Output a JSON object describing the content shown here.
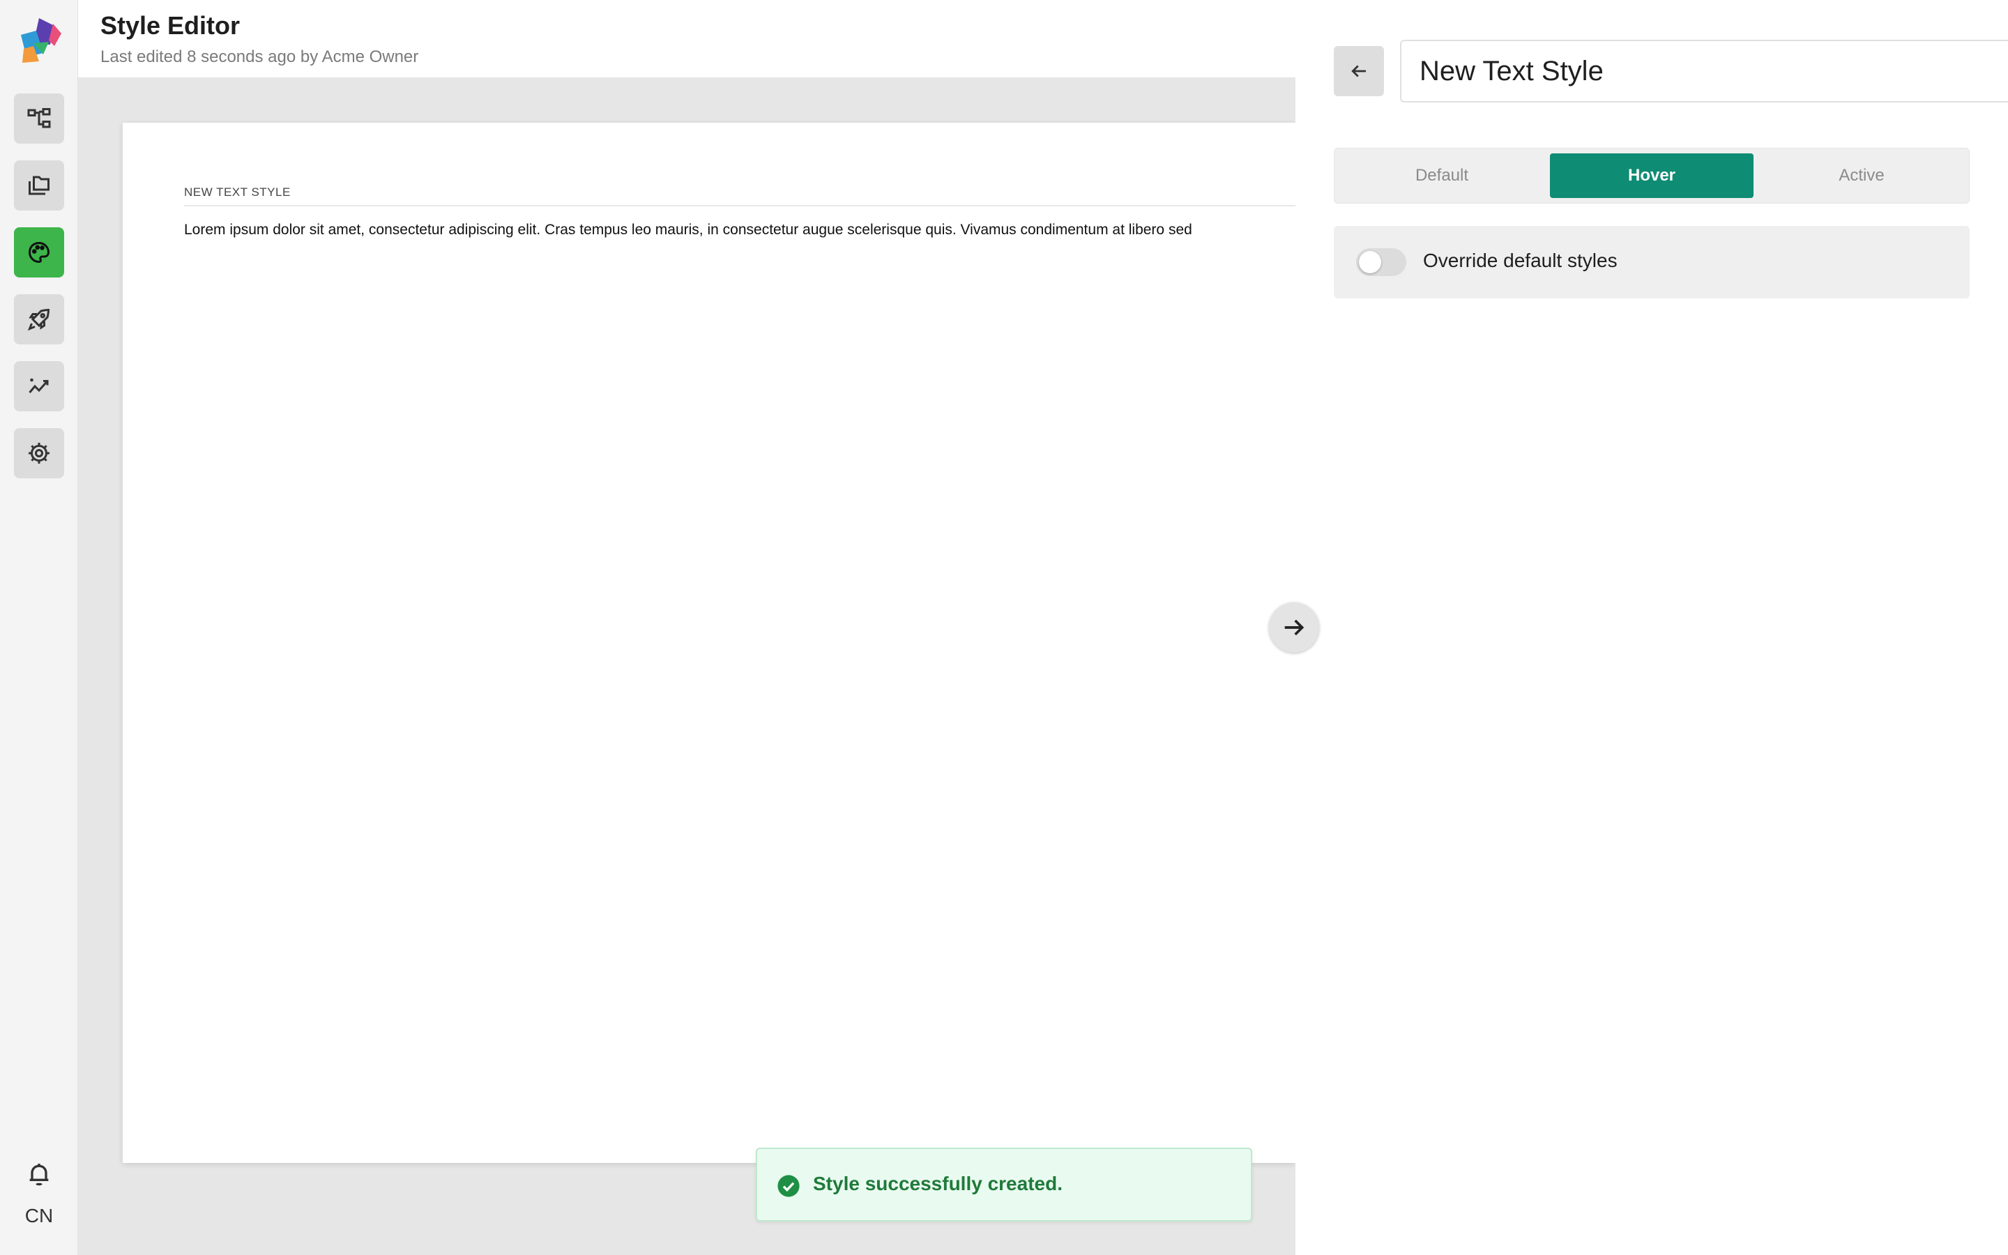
{
  "header": {
    "title": "Style Editor",
    "subtitle": "Last edited 8 seconds ago by Acme Owner"
  },
  "rail": {
    "items": [
      {
        "icon": "sitemap-icon",
        "active": false
      },
      {
        "icon": "files-icon",
        "active": false
      },
      {
        "icon": "palette-icon",
        "active": true
      },
      {
        "icon": "rocket-icon",
        "active": false
      },
      {
        "icon": "analytics-icon",
        "active": false
      },
      {
        "icon": "gear-icon",
        "active": false
      }
    ],
    "user_initials": "CN"
  },
  "page": {
    "style_heading": "NEW TEXT STYLE",
    "body_text": "Lorem ipsum dolor sit amet, consectetur adipiscing elit. Cras tempus leo mauris, in consectetur augue scelerisque quis. Vivamus condimentum at libero sed"
  },
  "panel": {
    "style_name": "New Text Style",
    "tabs": [
      {
        "label": "Default",
        "active": false
      },
      {
        "label": "Hover",
        "active": true
      },
      {
        "label": "Active",
        "active": false
      }
    ],
    "override_label": "Override default styles",
    "override_enabled": false
  },
  "toast": {
    "message": "Style successfully created."
  },
  "colors": {
    "accent": "#0e8c74",
    "active_nav": "#3db54a",
    "toast_text": "#1f7a3a"
  }
}
